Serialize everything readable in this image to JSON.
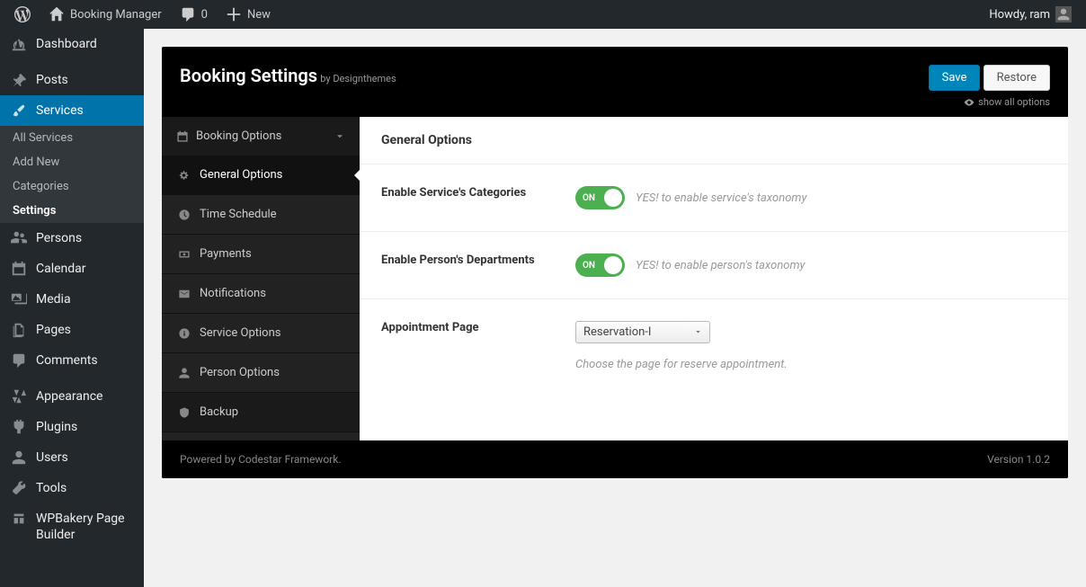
{
  "admin_bar": {
    "site_name": "Booking Manager",
    "comments_count": "0",
    "new_label": "New",
    "greeting": "Howdy, ram"
  },
  "sidebar": {
    "items": [
      {
        "label": "Dashboard",
        "icon": "dashboard"
      },
      {
        "label": "Posts",
        "icon": "pin"
      },
      {
        "label": "Services",
        "icon": "brush",
        "current": true,
        "submenu": [
          {
            "label": "All Services"
          },
          {
            "label": "Add New"
          },
          {
            "label": "Categories"
          },
          {
            "label": "Settings",
            "current": true
          }
        ]
      },
      {
        "label": "Persons",
        "icon": "users"
      },
      {
        "label": "Calendar",
        "icon": "calendar"
      },
      {
        "label": "Media",
        "icon": "media"
      },
      {
        "label": "Pages",
        "icon": "pages"
      },
      {
        "label": "Comments",
        "icon": "comment"
      },
      {
        "label": "Appearance",
        "icon": "appearance"
      },
      {
        "label": "Plugins",
        "icon": "plugin"
      },
      {
        "label": "Users",
        "icon": "user"
      },
      {
        "label": "Tools",
        "icon": "tools"
      },
      {
        "label": "WPBakery Page Builder",
        "icon": "wpb"
      }
    ]
  },
  "panel": {
    "title": "Booking Settings",
    "subtitle": "by Designthemes",
    "save_label": "Save",
    "restore_label": "Restore",
    "show_all_label": "show all options",
    "nav_heading": "Booking Options",
    "nav_items": [
      {
        "label": "General Options",
        "icon": "gear",
        "active": true
      },
      {
        "label": "Time Schedule",
        "icon": "clock"
      },
      {
        "label": "Payments",
        "icon": "money"
      },
      {
        "label": "Notifications",
        "icon": "mail"
      },
      {
        "label": "Service Options",
        "icon": "info"
      },
      {
        "label": "Person Options",
        "icon": "person"
      }
    ],
    "backup_label": "Backup",
    "section_title": "General Options",
    "fields": {
      "enable_categories": {
        "label": "Enable Service's Categories",
        "toggle_text": "ON",
        "hint": "YES! to enable service's taxonomy"
      },
      "enable_departments": {
        "label": "Enable Person's Departments",
        "toggle_text": "ON",
        "hint": "YES! to enable person's taxonomy"
      },
      "appointment_page": {
        "label": "Appointment Page",
        "selected": "Reservation-I",
        "desc": "Choose the page for reserve appointment."
      }
    },
    "footer_left": "Powered by Codestar Framework.",
    "footer_right": "Version 1.0.2"
  }
}
